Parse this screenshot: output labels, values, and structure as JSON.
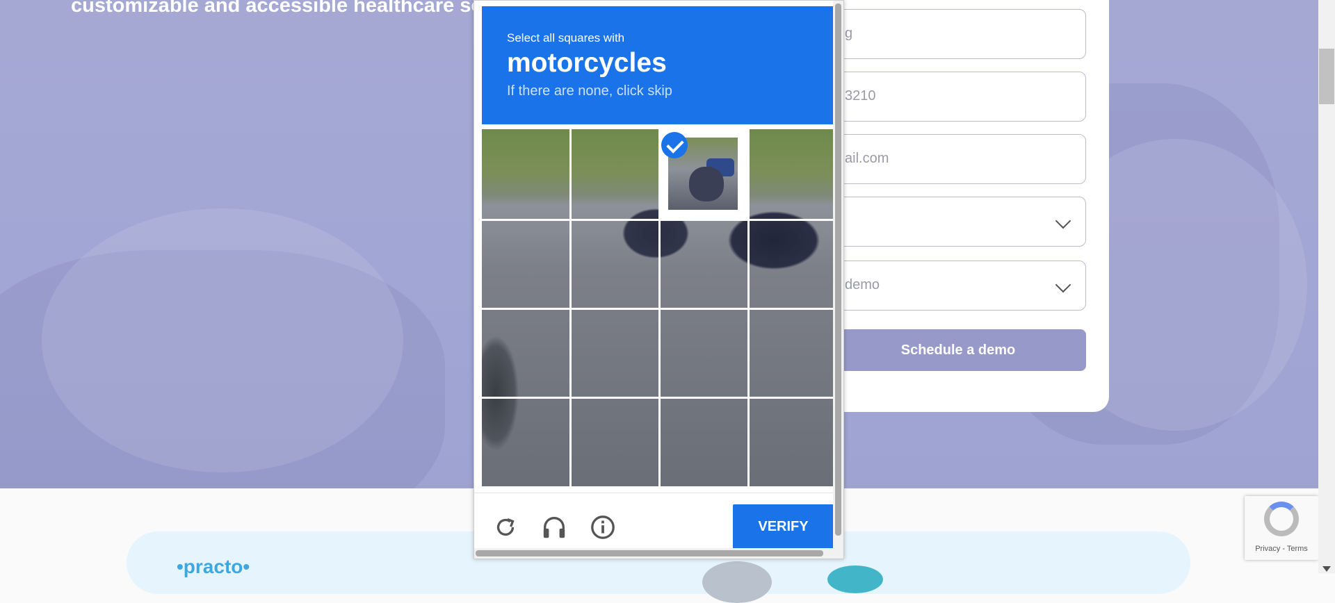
{
  "page": {
    "hero_text": "customizable and accessible healthcare solu",
    "form": {
      "fields": [
        {
          "name": "name-field",
          "placeholder": "g",
          "type": "text"
        },
        {
          "name": "phone-field",
          "placeholder": "3210",
          "type": "text"
        },
        {
          "name": "email-field",
          "placeholder": "ail.com",
          "type": "text"
        },
        {
          "name": "select-one",
          "placeholder": "",
          "type": "select"
        },
        {
          "name": "select-demo",
          "placeholder": "demo",
          "type": "select"
        }
      ],
      "submit_label": "Schedule a demo"
    },
    "partner_logo": "•practo•"
  },
  "captcha": {
    "instruction_line1": "Select all squares with",
    "target_object": "motorcycles",
    "instruction_line3": "If there are none, click skip",
    "grid_rows": 4,
    "grid_cols": 4,
    "selected_tiles": [
      [
        0,
        2
      ]
    ],
    "footer": {
      "icons": [
        "reload-icon",
        "audio-icon",
        "info-icon"
      ],
      "verify_label": "VERIFY"
    }
  },
  "recaptcha_badge": {
    "links": "Privacy - Terms"
  },
  "colors": {
    "captcha_blue": "#1a73e8",
    "hero_purple": "#a4a8d3",
    "submit_purple": "#9799c8"
  }
}
